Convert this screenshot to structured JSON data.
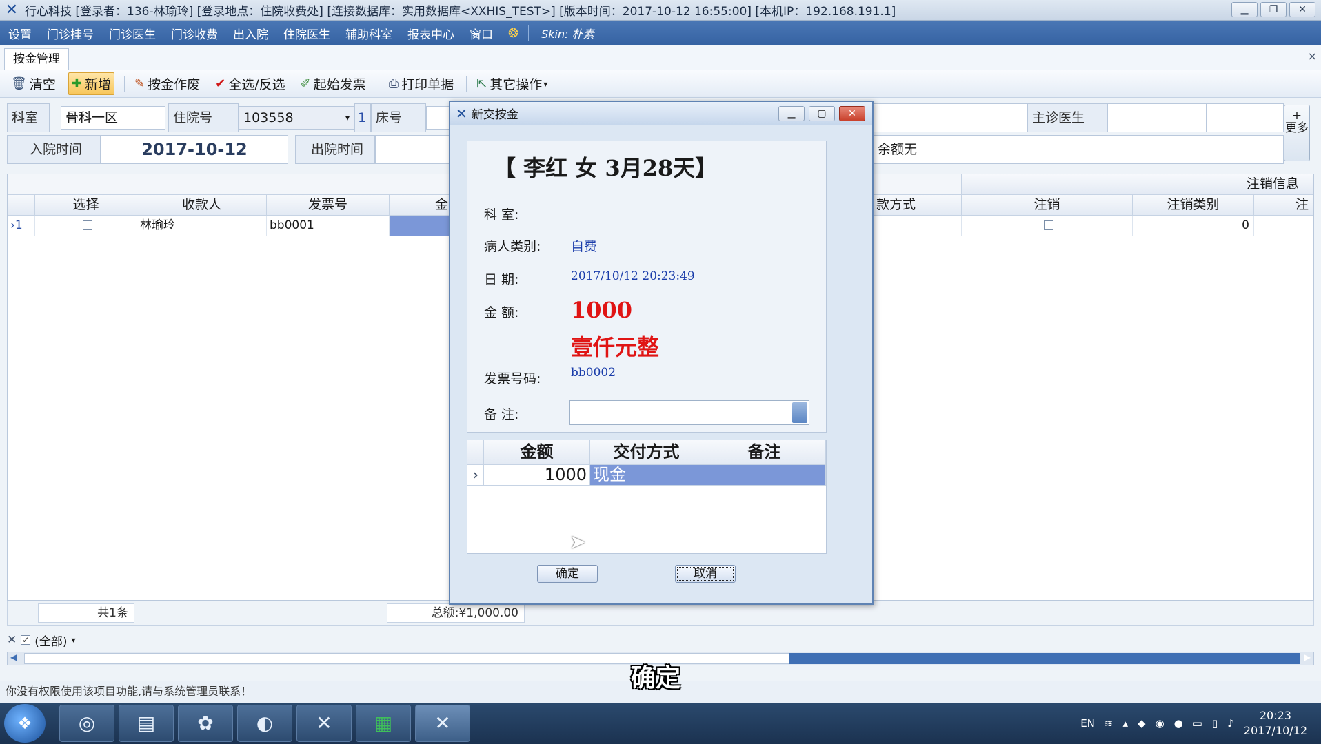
{
  "window": {
    "title": "行心科技   [登录者：136-林瑜玲]  [登录地点：住院收费处]  [连接数据库：实用数据库<XXHIS_TEST>]  [版本时间：2017-10-12 16:55:00]        [本机IP：192.168.191.1]"
  },
  "menu": {
    "items": [
      "设置",
      "门诊挂号",
      "门诊医生",
      "门诊收费",
      "出入院",
      "住院医生",
      "辅助科室",
      "报表中心",
      "窗口"
    ],
    "skin_label": "Skin: 朴素"
  },
  "tab": {
    "label": "按金管理",
    "close": "×"
  },
  "toolbar": {
    "clear": "清空",
    "add": "新增",
    "void": "按金作废",
    "select_all": "全选/反选",
    "start_invoice": "起始发票",
    "print": "打印单据",
    "other": "其它操作"
  },
  "form": {
    "dept_label": "科室",
    "dept_value": "骨科一区",
    "inpatient_label": "住院号",
    "inpatient_value": "103558",
    "inpatient_suffix": "1",
    "bed_label": "床号",
    "doctor_label": "主诊医生",
    "admit_label": "入院时间",
    "admit_value": "2017-10-12",
    "discharge_label": "出院时间",
    "balance_label": "余额无",
    "more_label": "+ 更多"
  },
  "grid": {
    "group_header": "注销信息",
    "headers": [
      "选择",
      "收款人",
      "发票号",
      "金",
      "款方式",
      "注销",
      "注销类别",
      "注"
    ],
    "row": {
      "index": "1",
      "payee": "林瑜玲",
      "invoice": "bb0001",
      "cancel_type": "0"
    },
    "footer_count": "共1条",
    "footer_total": "总额:¥1,000.00"
  },
  "filter": {
    "label": "(全部)"
  },
  "status": {
    "message": "你没有权限使用该项目功能,请与系统管理员联系！"
  },
  "subtitle": "确定",
  "dialog": {
    "title": "新交按金",
    "patient": "【 李红  女   3月28天】",
    "dept_label": "科    室:",
    "dept_value": "",
    "category_label": "病人类别:",
    "category_value": "自费",
    "date_label": "日    期:",
    "date_value": "2017/10/12 20:23:49",
    "amount_label": "金    额:",
    "amount_value": "1000",
    "amount_words": "壹仟元整",
    "invoice_label": "发票号码:",
    "invoice_value": "bb0002",
    "remark_label": "备    注:",
    "remark_value": "",
    "pay_headers": [
      "金额",
      "交付方式",
      "备注"
    ],
    "pay_row": {
      "amount": "1000",
      "method": "现金",
      "remark": ""
    },
    "ok": "确定",
    "cancel": "取消"
  },
  "taskbar": {
    "lang": "EN",
    "time": "20:23",
    "date": "2017/10/12"
  },
  "colors": {
    "menu_bar": "#3d6aa8",
    "amount_red": "#e01414",
    "value_blue": "#1a3caa",
    "selected_row": "#7b97d8"
  }
}
